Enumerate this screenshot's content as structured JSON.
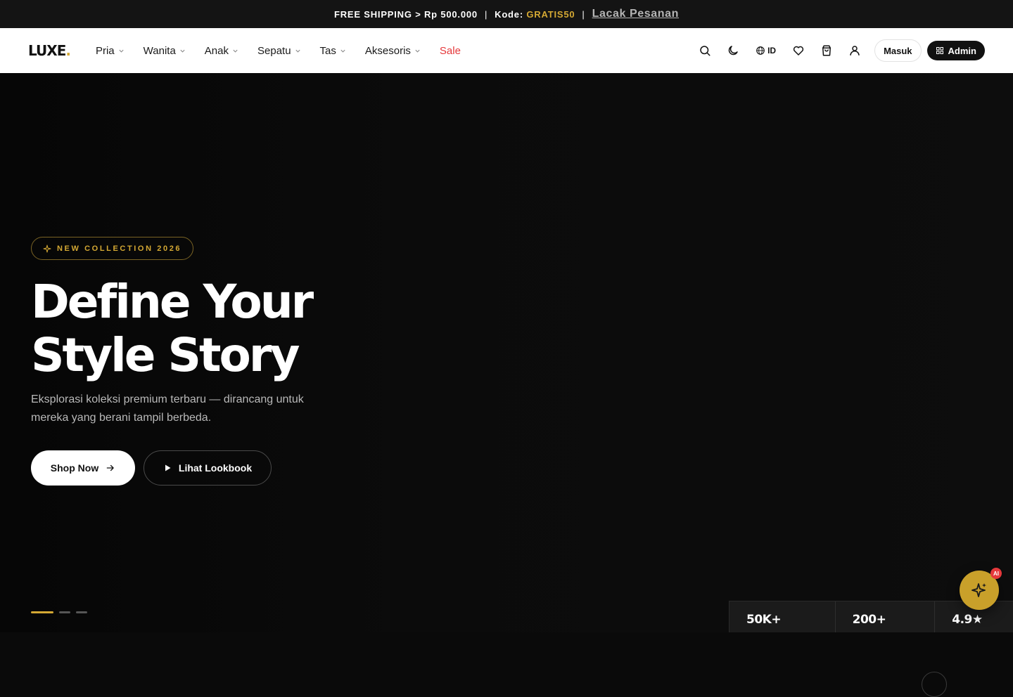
{
  "announcement": {
    "shipping": "FREE SHIPPING > Rp 500.000",
    "separator": "|",
    "code_label": "Kode:",
    "code_value": "GRATIS50",
    "track_label": "Lacak Pesanan"
  },
  "header": {
    "logo": "LUXE",
    "logo_dot": ".",
    "nav": [
      {
        "label": "Pria"
      },
      {
        "label": "Wanita"
      },
      {
        "label": "Anak"
      },
      {
        "label": "Sepatu"
      },
      {
        "label": "Tas"
      },
      {
        "label": "Aksesoris"
      },
      {
        "label": "Sale"
      }
    ],
    "language": "ID",
    "login_label": "Masuk",
    "admin_label": "Admin"
  },
  "hero": {
    "badge": "NEW COLLECTION 2026",
    "title_line1": "Define Your",
    "title_line2": "Style Story",
    "subtitle": "Eksplorasi koleksi premium terbaru — dirancang untuk mereka yang berani tampil berbeda.",
    "shop_label": "Shop Now",
    "lookbook_label": "Lihat Lookbook",
    "slide_count": 3,
    "active_slide": 1
  },
  "stats": [
    {
      "value": "50K+"
    },
    {
      "value": "200+"
    },
    {
      "value": "4.9★"
    }
  ],
  "ai": {
    "badge": "AI"
  },
  "colors": {
    "accent": "#d4a833",
    "sale": "#e5383b",
    "dark": "#111111"
  },
  "icons": [
    "search-icon",
    "moon-icon",
    "globe-icon",
    "heart-icon",
    "bag-icon",
    "user-icon",
    "grid-icon",
    "sparkle-icon",
    "arrow-right-icon",
    "play-icon",
    "chevron-down-icon"
  ]
}
